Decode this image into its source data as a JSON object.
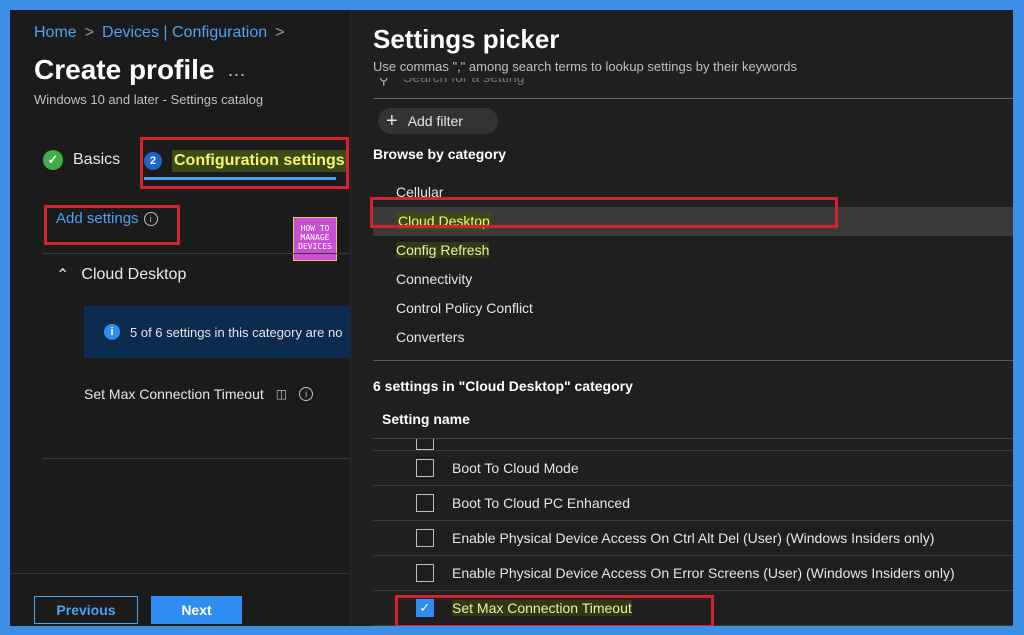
{
  "breadcrumb": [
    "Home",
    "Devices | Configuration"
  ],
  "page": {
    "title": "Create profile",
    "more": "...",
    "subtitle": "Windows 10 and later - Settings catalog"
  },
  "steps": [
    {
      "number": "✓",
      "label": "Basics"
    },
    {
      "number": "2",
      "label": "Configuration settings"
    }
  ],
  "add_settings": "Add settings",
  "logo_text": [
    "HOW TO",
    "MANAGE",
    "DEVICES"
  ],
  "category_section": {
    "title": "Cloud Desktop",
    "info": "5 of 6 settings in this category are no",
    "setting": "Set Max Connection Timeout"
  },
  "footer": {
    "previous": "Previous",
    "next": "Next"
  },
  "picker": {
    "title": "Settings picker",
    "subtitle": "Use commas \",\" among search terms to lookup settings by their keywords",
    "search_placeholder": "Search for a setting",
    "add_filter": "Add filter",
    "browse_label": "Browse by category",
    "categories": [
      "Cellular",
      "Cloud Desktop",
      "Config Refresh",
      "Connectivity",
      "Control Policy Conflict",
      "Converters"
    ],
    "selected_category": "Cloud Desktop",
    "count_label": "6 settings in \"Cloud Desktop\" category",
    "column_header": "Setting name",
    "settings": [
      {
        "name": "Boot To Cloud Mode",
        "checked": false
      },
      {
        "name": "Boot To Cloud PC Enhanced",
        "checked": false
      },
      {
        "name": "Enable Physical Device Access On Ctrl Alt Del (User) (Windows Insiders only)",
        "checked": false
      },
      {
        "name": "Enable Physical Device Access On Error Screens (User) (Windows Insiders only)",
        "checked": false
      },
      {
        "name": "Set Max Connection Timeout",
        "checked": true
      }
    ]
  },
  "colors": {
    "accent": "#2f8cf0",
    "highlight_box": "#d3232f",
    "background": "#1b1b1b",
    "frame": "#3d8ee6"
  }
}
